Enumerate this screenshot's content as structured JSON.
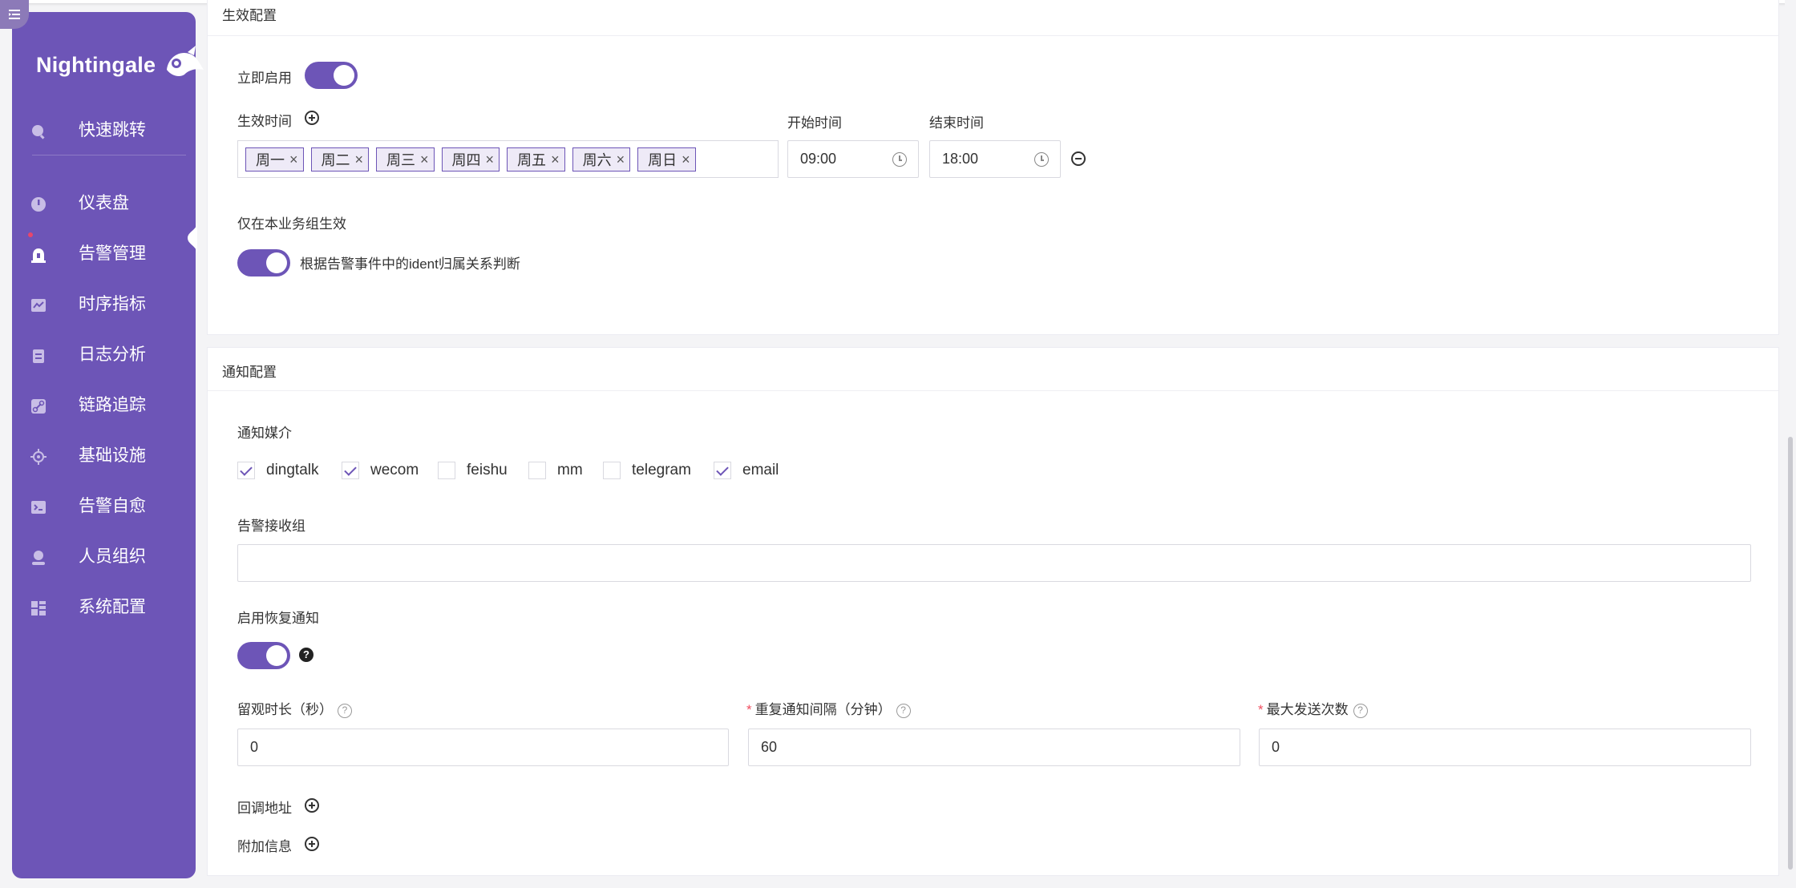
{
  "app": {
    "brand": "Nightingale"
  },
  "sidebar": {
    "items": [
      {
        "label": "快速跳转",
        "icon": "search-icon"
      },
      {
        "label": "仪表盘",
        "icon": "dashboard-icon"
      },
      {
        "label": "告警管理",
        "icon": "alarm-icon",
        "active": true
      },
      {
        "label": "时序指标",
        "icon": "metrics-chart-icon"
      },
      {
        "label": "日志分析",
        "icon": "log-document-icon"
      },
      {
        "label": "链路追踪",
        "icon": "link-icon"
      },
      {
        "label": "基础设施",
        "icon": "crosshair-icon"
      },
      {
        "label": "告警自愈",
        "icon": "terminal-icon"
      },
      {
        "label": "人员组织",
        "icon": "user-icon"
      },
      {
        "label": "系统配置",
        "icon": "grid-settings-icon"
      }
    ]
  },
  "effective": {
    "title": "生效配置",
    "enable_label": "立即启用",
    "enabled": true,
    "time_label": "生效时间",
    "start_label": "开始时间",
    "end_label": "结束时间",
    "days": [
      "周一",
      "周二",
      "周三",
      "周四",
      "周五",
      "周六",
      "周日"
    ],
    "start_time": "09:00",
    "end_time": "18:00",
    "group_only_label": "仅在本业务组生效",
    "group_only_enabled": true,
    "group_only_hint": "根据告警事件中的ident归属关系判断"
  },
  "notify": {
    "title": "通知配置",
    "media_label": "通知媒介",
    "channels": [
      {
        "label": "dingtalk",
        "checked": true
      },
      {
        "label": "wecom",
        "checked": true
      },
      {
        "label": "feishu",
        "checked": false
      },
      {
        "label": "mm",
        "checked": false
      },
      {
        "label": "telegram",
        "checked": false
      },
      {
        "label": "email",
        "checked": true
      }
    ],
    "receiver_label": "告警接收组",
    "receiver_value": "",
    "recover_label": "启用恢复通知",
    "recover_enabled": true,
    "observe_label": "留观时长（秒）",
    "observe_value": "0",
    "repeat_label": "重复通知间隔（分钟）",
    "repeat_value": "60",
    "max_label": "最大发送次数",
    "max_value": "0",
    "callback_label": "回调地址",
    "extra_label": "附加信息"
  },
  "colors": {
    "brand": "#6d55b7",
    "required": "#f04e60"
  }
}
